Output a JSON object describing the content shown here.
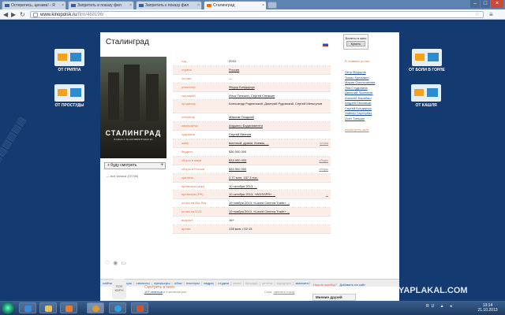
{
  "browser": {
    "tabs": [
      {
        "label": "Остерегись, цензма! - Я"
      },
      {
        "label": "Запретить в показу фил"
      },
      {
        "label": "Запретить к показу фил"
      },
      {
        "label": "Сталинград"
      }
    ],
    "url_host": "www.kinopoisk.ru",
    "url_path": "/film/468196/"
  },
  "ads": {
    "left_top": "ОТ ГРИППА",
    "left_bottom": "ОТ ПРОСТУДЫ",
    "right_top": "ОТ БОЛИ В ГОРЛЕ",
    "right_bottom": "ОТ КАШЛЯ"
  },
  "film": {
    "title": "Сталинград",
    "ticket_label": "Билеты в кино",
    "ticket_button": "Купить",
    "poster_title": "СТАЛИНГРАД",
    "poster_sub": "В КИНО С 10 ОКТЯБРЯ В IMAX 3D",
    "watch_button": "+ буду смотреть",
    "votes": "— все записи (10796)",
    "rows": [
      {
        "k": "год",
        "v": "2013"
      },
      {
        "k": "страна",
        "v": "Россия"
      },
      {
        "k": "слоган",
        "v": "—"
      },
      {
        "k": "режиссер",
        "v": "Фёдор Бондарчук"
      },
      {
        "k": "сценарий",
        "v": "Илья Тилькин, Сергей Снежкин"
      },
      {
        "k": "продюсер",
        "v": "Александр Роднянский, Дмитрий Рудовский, Сергей Мельгунов"
      },
      {
        "k": "оператор",
        "v": "Максим Осадчий"
      },
      {
        "k": "композитор",
        "v": "Анджело Бадаламенти"
      },
      {
        "k": "художник",
        "v": "Сергей Иванов"
      },
      {
        "k": "жанр",
        "v": "военный, драма, боевик, ...",
        "r": "слова"
      },
      {
        "k": "бюджет",
        "v": "$30 000 000"
      },
      {
        "k": "сборы в мире",
        "v": "$33 900 000",
        "r": "сборы"
      },
      {
        "k": "сборы в России",
        "v": "$33 500 000",
        "r": "сборы"
      },
      {
        "k": "зрители",
        "v": "2.77 млн,        187.3 тыс."
      },
      {
        "k": "премьера (мир)",
        "v": "10 октября 2013, ..."
      },
      {
        "k": "премьера (РФ)",
        "v": "10 октября 2013, «WDSSPR» ...",
        "r": "..."
      },
      {
        "k": "релиз на Blu-Ray",
        "v": "19 ноября 2013, «Lizard Cinema Trade» ..."
      },
      {
        "k": "релиз на DVD",
        "v": "19 ноября 2013, «Lizard Cinema Trade» ..."
      },
      {
        "k": "возраст",
        "v": "16+"
      },
      {
        "k": "время",
        "v": "135 мин. / 02:15"
      }
    ],
    "cast_header": "В главных ролях:",
    "cast": [
      "Пётр Фёдоров",
      "Томас Кречманн",
      "Мария Смольникова",
      "Яна Студилина",
      "Дмитрий Лысенков",
      "Алексей Барабаш",
      "Андрей Смоляков",
      "Сергей Бондарчук",
      "Хайнер Лаутербах",
      "Олег Тилькин"
    ],
    "cast_more": "посмотреть всех"
  },
  "navbar": {
    "items": [
      "сайты",
      "трейлеры",
      "сиквелы",
      "премьеры",
      "обои",
      "постеры",
      "кадры",
      "студии",
      "связи",
      "награды",
      "цитаты",
      "саундтрек",
      "заказать!"
    ]
  },
  "footer": {
    "popcorn": "ПОП КОРН",
    "line1": "Смотреть в кино",
    "line2a": "107 сеансов",
    "line2b": "в 6 кинотеатрах",
    "city": "Сочи",
    "city_link": "сменить город",
    "note1": "Нашли ошибку?",
    "note2": "Добавить на сайт",
    "friends": "Мнение друзей"
  },
  "watermark": "YAPLAKAL.COM",
  "taskbar": {
    "lang": "RU",
    "time": "13:14",
    "date": "21.10.2013"
  }
}
